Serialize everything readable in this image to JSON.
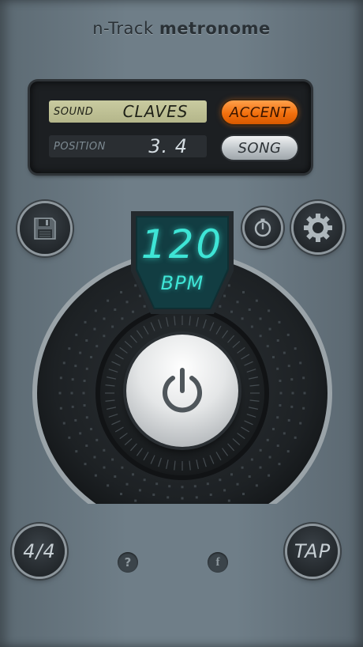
{
  "header": {
    "title_light": "n-Track ",
    "title_bold": "metronome"
  },
  "display": {
    "sound_label": "SOUND",
    "sound_value": "CLAVES",
    "position_label": "POSITION",
    "position_value": "3. 4",
    "accent_label": "ACCENT",
    "song_label": "SONG"
  },
  "tempo": {
    "bpm": "120",
    "unit": "BPM"
  },
  "controls": {
    "time_signature": "4/4",
    "tap_label": "TAP",
    "help_glyph": "?",
    "facebook_glyph": "f"
  },
  "icons": [
    "save-icon",
    "timer-icon",
    "gear-icon",
    "power-icon",
    "help-icon",
    "facebook-icon"
  ],
  "colors": {
    "accent": "#f2700e",
    "lcd_cyan": "#3ee5d6",
    "lcd_green": "#c9cba0"
  }
}
